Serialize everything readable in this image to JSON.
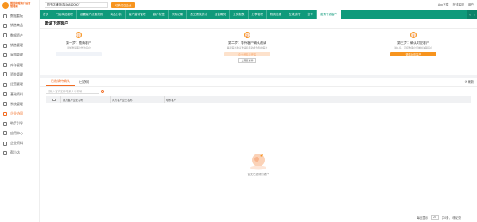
{
  "brand": {
    "line1": "图图助理商户后台",
    "line2": "管理端"
  },
  "sidebar": {
    "items": [
      {
        "label": "数据看板",
        "icon": "dashboard-icon",
        "active": false
      },
      {
        "label": "销售商品",
        "icon": "goods-icon",
        "active": false
      },
      {
        "label": "数据资产",
        "icon": "assets-icon",
        "active": false
      },
      {
        "label": "销售管理",
        "icon": "sales-icon",
        "active": false
      },
      {
        "label": "采购管理",
        "icon": "purchase-icon",
        "active": false
      },
      {
        "label": "库存管理",
        "icon": "inventory-icon",
        "active": false
      },
      {
        "label": "资金管理",
        "icon": "wallet-icon",
        "active": false
      },
      {
        "label": "经营管理",
        "icon": "chart-icon",
        "active": false
      },
      {
        "label": "基础资料",
        "icon": "book-icon",
        "active": false
      },
      {
        "label": "系统管理",
        "icon": "gear-icon",
        "active": false
      },
      {
        "label": "企业协同",
        "icon": "team-icon",
        "active": true
      },
      {
        "label": "助手引导",
        "icon": "guide-icon",
        "active": false
      },
      {
        "label": "应用中心",
        "icon": "app-icon",
        "active": false
      },
      {
        "label": "企业资料",
        "icon": "profile-icon",
        "active": false
      },
      {
        "label": "帮小店",
        "icon": "store-icon",
        "active": false
      }
    ]
  },
  "topbar": {
    "shop": "图书店铺测试1568120507",
    "switch_btn": "切换门店企业",
    "right": [
      "App下载",
      "在线客服",
      "用户"
    ]
  },
  "nav": {
    "items": [
      {
        "label": "首页",
        "active": false
      },
      {
        "label": "门店商品管理",
        "active": false
      },
      {
        "label": "设置客户优惠规则",
        "active": false
      },
      {
        "label": "商品分析",
        "active": false
      },
      {
        "label": "客户营销管理",
        "active": false
      },
      {
        "label": "客户标签",
        "active": false
      },
      {
        "label": "采购记录",
        "active": false
      },
      {
        "label": "员工绩效统计",
        "active": false
      },
      {
        "label": "经营概况",
        "active": false
      },
      {
        "label": "业务报表",
        "active": false
      },
      {
        "label": "分享管理",
        "active": false
      },
      {
        "label": "物流信息",
        "active": false
      },
      {
        "label": "在线支付",
        "active": false
      },
      {
        "label": "账号",
        "active": false
      },
      {
        "label": "邀请下游客户",
        "active": true
      }
    ]
  },
  "page": {
    "title": "邀请下游客户"
  },
  "steps": [
    {
      "num": "1",
      "title": "第一步：邀请客户",
      "desc": "添加邀请客户作为客户",
      "btn": "",
      "btn_style": "ghost",
      "link": ""
    },
    {
      "num": "2",
      "title": "第二步：等待客户确认邀请",
      "desc": "等待客户确认邀请后自动成为您的客户",
      "btn": "企业资料未完善",
      "btn_style": "light",
      "link": "去完善资料"
    },
    {
      "num": "3",
      "title": "第三步：确认对应客户",
      "desc": "进入后，可接收客户订单并关联客户",
      "btn": "邀请对应客户",
      "btn_style": "solid",
      "link": ""
    }
  ],
  "tabs": [
    {
      "label": "已邀请待确认",
      "active": true
    },
    {
      "label": "已协同",
      "active": false
    }
  ],
  "refresh": "刷新",
  "filter": {
    "placeholder": "请输入客户名称/联系人/手机号"
  },
  "table": {
    "headers": [
      "我方客户企业名称",
      "对方客户企业名称",
      "联系客户"
    ]
  },
  "empty": {
    "text": "暂无已邀请的客户"
  },
  "pager": {
    "page_size_label": "每页显示",
    "page_size": "20",
    "summary": "共0条，0条记录"
  }
}
